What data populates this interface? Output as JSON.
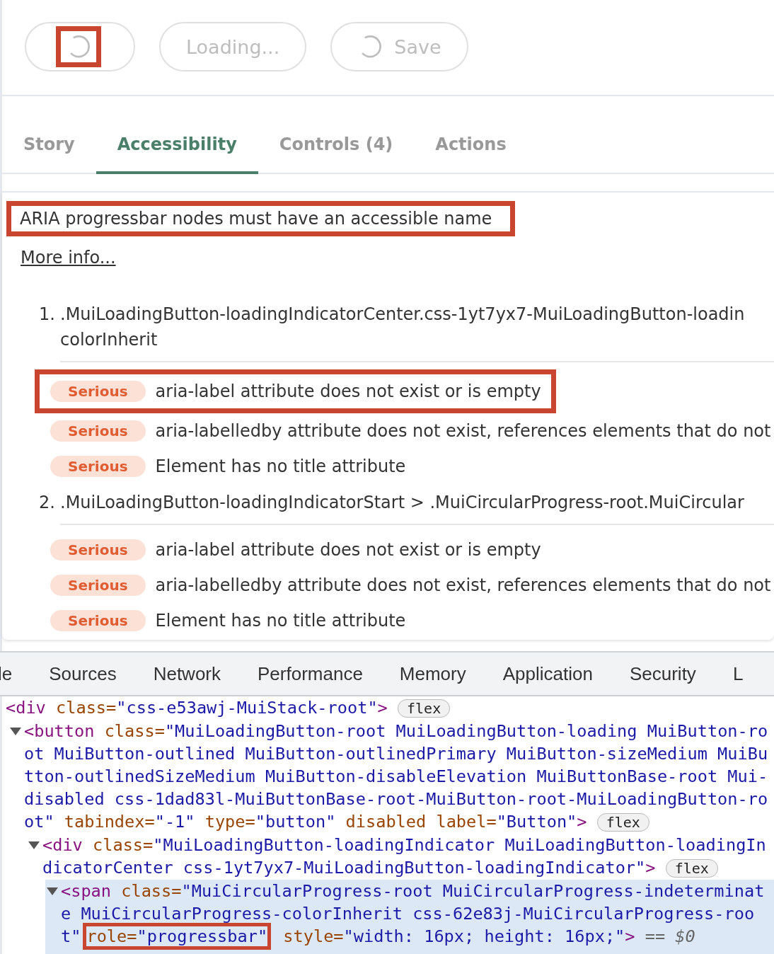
{
  "preview_buttons": [
    {
      "kind": "spinner",
      "highlighted": true
    },
    {
      "kind": "text",
      "label": "Loading..."
    },
    {
      "kind": "spinner-text",
      "label": "Save"
    }
  ],
  "tabs": [
    {
      "label": "Story",
      "selected": false
    },
    {
      "label": "Accessibility",
      "selected": true
    },
    {
      "label": "Controls (4)",
      "selected": false
    },
    {
      "label": "Actions",
      "selected": false
    }
  ],
  "violation": {
    "title": "ARIA progressbar nodes must have an accessible name",
    "highlighted": true,
    "link": "More info..."
  },
  "nodes": [
    {
      "number": "1.",
      "selector": [
        ".MuiLoadingButton-loadingIndicatorCenter.css-1yt7yx7-MuiLoadingButton-loadin",
        "colorInherit"
      ],
      "issues": [
        {
          "severity": "Serious",
          "text": "aria-label attribute does not exist or is empty",
          "highlighted": true
        },
        {
          "severity": "Serious",
          "text": "aria-labelledby attribute does not exist, references elements that do not",
          "highlighted": false
        },
        {
          "severity": "Serious",
          "text": "Element has no title attribute",
          "highlighted": false
        }
      ]
    },
    {
      "number": "2.",
      "selector": [
        ".MuiLoadingButton-loadingIndicatorStart > .MuiCircularProgress-root.MuiCircular"
      ],
      "issues": [
        {
          "severity": "Serious",
          "text": "aria-label attribute does not exist or is empty",
          "highlighted": false
        },
        {
          "severity": "Serious",
          "text": "aria-labelledby attribute does not exist, references elements that do not",
          "highlighted": false
        },
        {
          "severity": "Serious",
          "text": "Element has no title attribute",
          "highlighted": false
        }
      ]
    }
  ],
  "devtools_tabs": [
    "le",
    "Sources",
    "Network",
    "Performance",
    "Memory",
    "Application",
    "Security",
    "L"
  ],
  "elements": [
    {
      "expanded": false,
      "selected": false,
      "badge": "flex",
      "tokens": [
        {
          "kind": "tag",
          "text": "<div"
        },
        {
          "kind": "attr",
          "text": " class="
        },
        {
          "kind": "value",
          "text": "\"css-e53awj-MuiStack-root\""
        },
        {
          "kind": "tag",
          "text": ">"
        }
      ],
      "children": [
        {
          "expanded": true,
          "selected": false,
          "badge": "flex",
          "tokens": [
            {
              "kind": "tag",
              "text": "<button"
            },
            {
              "kind": "attr",
              "text": " class="
            },
            {
              "kind": "value",
              "text": "\"MuiLoadingButton-root MuiLoadingButton-loading MuiButton-root MuiButton-outlined MuiButton-outlinedPrimary MuiButton-sizeMedium MuiButton-outlinedSizeMedium MuiButton-disableElevation MuiButtonBase-root Mui-disabled css-1dad83l-MuiButtonBase-root-MuiButton-root-MuiLoadingButton-root\""
            },
            {
              "kind": "attr",
              "text": " tabindex="
            },
            {
              "kind": "value",
              "text": "\"-1\""
            },
            {
              "kind": "attr",
              "text": " type="
            },
            {
              "kind": "value",
              "text": "\"button\""
            },
            {
              "kind": "attr",
              "text": " disabled label="
            },
            {
              "kind": "value",
              "text": "\"Button\""
            },
            {
              "kind": "tag",
              "text": ">"
            }
          ],
          "children": [
            {
              "expanded": true,
              "selected": false,
              "badge": "flex",
              "tokens": [
                {
                  "kind": "tag",
                  "text": "<div"
                },
                {
                  "kind": "attr",
                  "text": " class="
                },
                {
                  "kind": "value",
                  "text": "\"MuiLoadingButton-loadingIndicator MuiLoadingButton-loadingIndicatorCenter css-1yt7yx7-MuiLoadingButton-loadingIndicator\""
                },
                {
                  "kind": "tag",
                  "text": ">"
                }
              ],
              "children": [
                {
                  "expanded": true,
                  "selected": true,
                  "tokens": [
                    {
                      "kind": "tag",
                      "text": "<span"
                    },
                    {
                      "kind": "attr",
                      "text": " class="
                    },
                    {
                      "kind": "value",
                      "text": "\"MuiCircularProgress-root MuiCircularProgress-indeterminate MuiCircularProgress-colorInherit css-62e83j-MuiCircularProgress-root\""
                    },
                    {
                      "kind": "group",
                      "highlighted": true,
                      "tokens": [
                        {
                          "kind": "attr",
                          "text": "role="
                        },
                        {
                          "kind": "value",
                          "text": "\"progressbar\""
                        }
                      ]
                    },
                    {
                      "kind": "attr",
                      "text": " style="
                    },
                    {
                      "kind": "value",
                      "text": "\"width: 16px; height: 16px;\""
                    },
                    {
                      "kind": "tag",
                      "text": ">"
                    },
                    {
                      "kind": "note",
                      "text": " == $0"
                    }
                  ]
                }
              ]
            }
          ]
        }
      ]
    }
  ]
}
